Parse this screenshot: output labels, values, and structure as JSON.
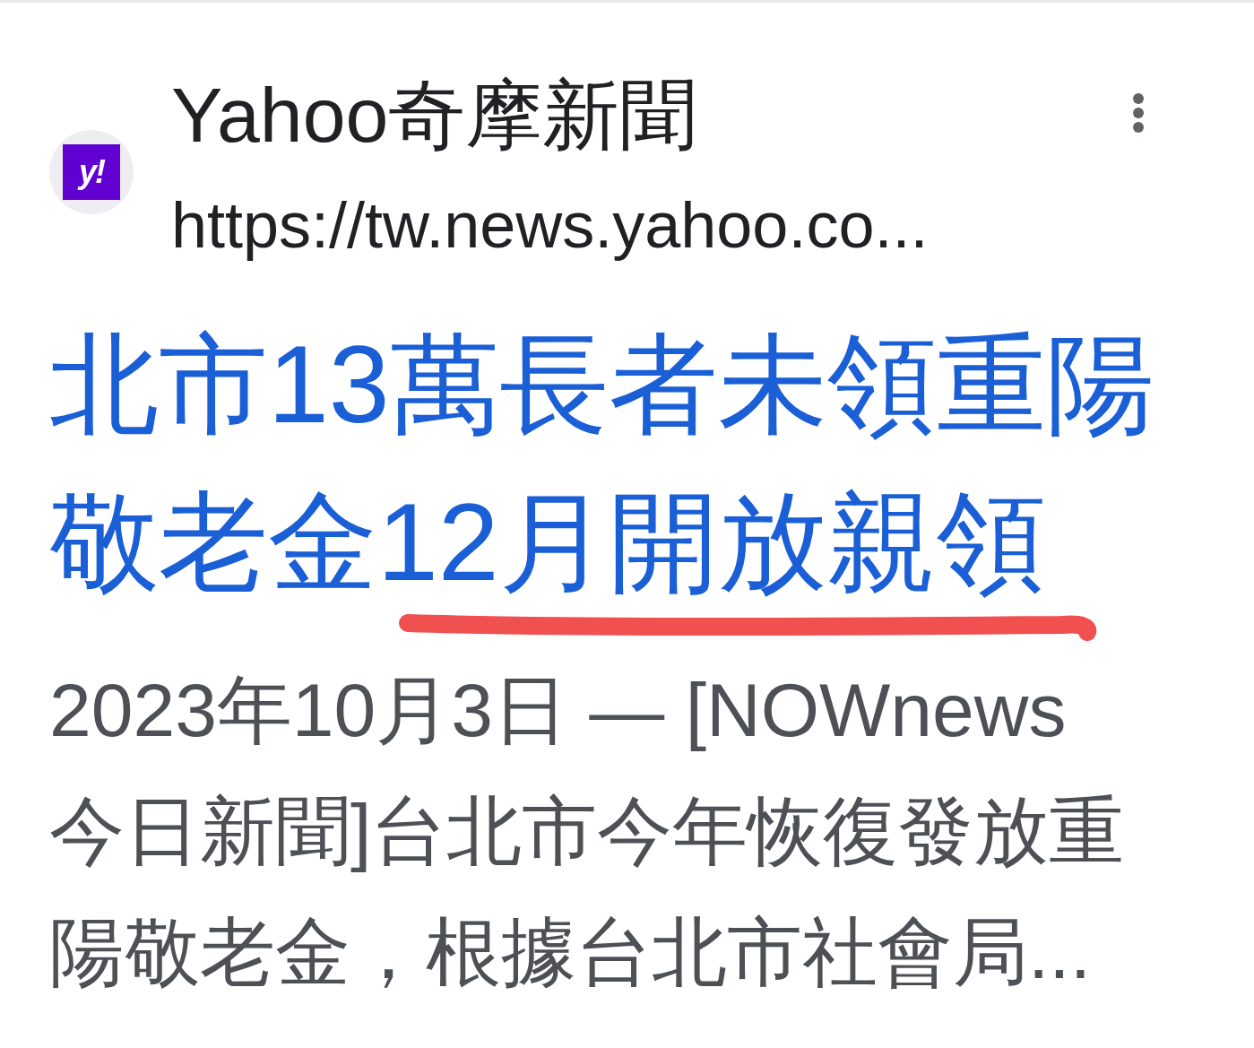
{
  "result": {
    "favicon": {
      "text": "y!"
    },
    "site_name": "Yahoo奇摩新聞",
    "url": "https://tw.news.yahoo.co...",
    "title_lines": [
      "北市13萬長者未領重陽",
      "敬老金12月開放親領"
    ],
    "snippet_lines": [
      "2023年10月3日 — [NOWnews",
      "今日新聞]台北市今年恢復發放重",
      "陽敬老金，根據台北市社會局..."
    ]
  }
}
